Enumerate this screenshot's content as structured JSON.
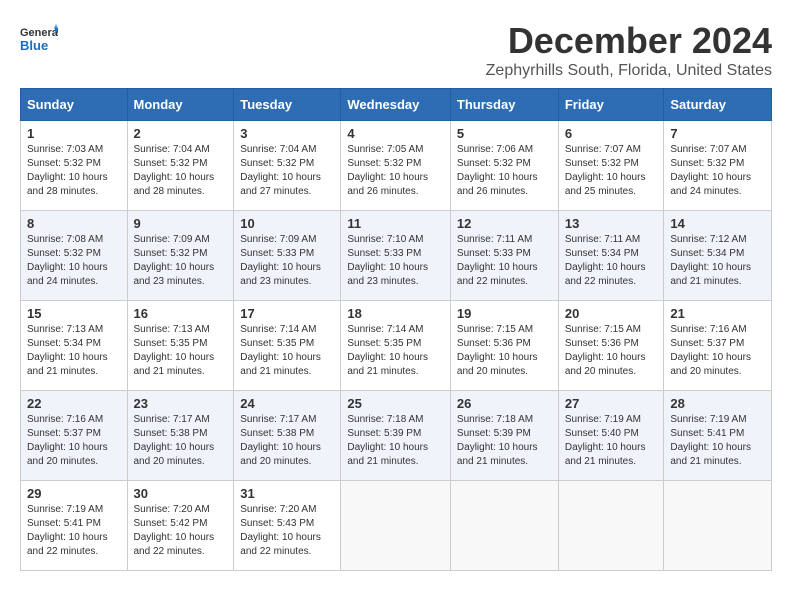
{
  "header": {
    "logo_general": "General",
    "logo_blue": "Blue",
    "month_title": "December 2024",
    "location": "Zephyrhills South, Florida, United States"
  },
  "weekdays": [
    "Sunday",
    "Monday",
    "Tuesday",
    "Wednesday",
    "Thursday",
    "Friday",
    "Saturday"
  ],
  "weeks": [
    [
      {
        "day": "1",
        "sunrise": "Sunrise: 7:03 AM",
        "sunset": "Sunset: 5:32 PM",
        "daylight": "Daylight: 10 hours and 28 minutes."
      },
      {
        "day": "2",
        "sunrise": "Sunrise: 7:04 AM",
        "sunset": "Sunset: 5:32 PM",
        "daylight": "Daylight: 10 hours and 28 minutes."
      },
      {
        "day": "3",
        "sunrise": "Sunrise: 7:04 AM",
        "sunset": "Sunset: 5:32 PM",
        "daylight": "Daylight: 10 hours and 27 minutes."
      },
      {
        "day": "4",
        "sunrise": "Sunrise: 7:05 AM",
        "sunset": "Sunset: 5:32 PM",
        "daylight": "Daylight: 10 hours and 26 minutes."
      },
      {
        "day": "5",
        "sunrise": "Sunrise: 7:06 AM",
        "sunset": "Sunset: 5:32 PM",
        "daylight": "Daylight: 10 hours and 26 minutes."
      },
      {
        "day": "6",
        "sunrise": "Sunrise: 7:07 AM",
        "sunset": "Sunset: 5:32 PM",
        "daylight": "Daylight: 10 hours and 25 minutes."
      },
      {
        "day": "7",
        "sunrise": "Sunrise: 7:07 AM",
        "sunset": "Sunset: 5:32 PM",
        "daylight": "Daylight: 10 hours and 24 minutes."
      }
    ],
    [
      {
        "day": "8",
        "sunrise": "Sunrise: 7:08 AM",
        "sunset": "Sunset: 5:32 PM",
        "daylight": "Daylight: 10 hours and 24 minutes."
      },
      {
        "day": "9",
        "sunrise": "Sunrise: 7:09 AM",
        "sunset": "Sunset: 5:32 PM",
        "daylight": "Daylight: 10 hours and 23 minutes."
      },
      {
        "day": "10",
        "sunrise": "Sunrise: 7:09 AM",
        "sunset": "Sunset: 5:33 PM",
        "daylight": "Daylight: 10 hours and 23 minutes."
      },
      {
        "day": "11",
        "sunrise": "Sunrise: 7:10 AM",
        "sunset": "Sunset: 5:33 PM",
        "daylight": "Daylight: 10 hours and 23 minutes."
      },
      {
        "day": "12",
        "sunrise": "Sunrise: 7:11 AM",
        "sunset": "Sunset: 5:33 PM",
        "daylight": "Daylight: 10 hours and 22 minutes."
      },
      {
        "day": "13",
        "sunrise": "Sunrise: 7:11 AM",
        "sunset": "Sunset: 5:34 PM",
        "daylight": "Daylight: 10 hours and 22 minutes."
      },
      {
        "day": "14",
        "sunrise": "Sunrise: 7:12 AM",
        "sunset": "Sunset: 5:34 PM",
        "daylight": "Daylight: 10 hours and 21 minutes."
      }
    ],
    [
      {
        "day": "15",
        "sunrise": "Sunrise: 7:13 AM",
        "sunset": "Sunset: 5:34 PM",
        "daylight": "Daylight: 10 hours and 21 minutes."
      },
      {
        "day": "16",
        "sunrise": "Sunrise: 7:13 AM",
        "sunset": "Sunset: 5:35 PM",
        "daylight": "Daylight: 10 hours and 21 minutes."
      },
      {
        "day": "17",
        "sunrise": "Sunrise: 7:14 AM",
        "sunset": "Sunset: 5:35 PM",
        "daylight": "Daylight: 10 hours and 21 minutes."
      },
      {
        "day": "18",
        "sunrise": "Sunrise: 7:14 AM",
        "sunset": "Sunset: 5:35 PM",
        "daylight": "Daylight: 10 hours and 21 minutes."
      },
      {
        "day": "19",
        "sunrise": "Sunrise: 7:15 AM",
        "sunset": "Sunset: 5:36 PM",
        "daylight": "Daylight: 10 hours and 20 minutes."
      },
      {
        "day": "20",
        "sunrise": "Sunrise: 7:15 AM",
        "sunset": "Sunset: 5:36 PM",
        "daylight": "Daylight: 10 hours and 20 minutes."
      },
      {
        "day": "21",
        "sunrise": "Sunrise: 7:16 AM",
        "sunset": "Sunset: 5:37 PM",
        "daylight": "Daylight: 10 hours and 20 minutes."
      }
    ],
    [
      {
        "day": "22",
        "sunrise": "Sunrise: 7:16 AM",
        "sunset": "Sunset: 5:37 PM",
        "daylight": "Daylight: 10 hours and 20 minutes."
      },
      {
        "day": "23",
        "sunrise": "Sunrise: 7:17 AM",
        "sunset": "Sunset: 5:38 PM",
        "daylight": "Daylight: 10 hours and 20 minutes."
      },
      {
        "day": "24",
        "sunrise": "Sunrise: 7:17 AM",
        "sunset": "Sunset: 5:38 PM",
        "daylight": "Daylight: 10 hours and 20 minutes."
      },
      {
        "day": "25",
        "sunrise": "Sunrise: 7:18 AM",
        "sunset": "Sunset: 5:39 PM",
        "daylight": "Daylight: 10 hours and 21 minutes."
      },
      {
        "day": "26",
        "sunrise": "Sunrise: 7:18 AM",
        "sunset": "Sunset: 5:39 PM",
        "daylight": "Daylight: 10 hours and 21 minutes."
      },
      {
        "day": "27",
        "sunrise": "Sunrise: 7:19 AM",
        "sunset": "Sunset: 5:40 PM",
        "daylight": "Daylight: 10 hours and 21 minutes."
      },
      {
        "day": "28",
        "sunrise": "Sunrise: 7:19 AM",
        "sunset": "Sunset: 5:41 PM",
        "daylight": "Daylight: 10 hours and 21 minutes."
      }
    ],
    [
      {
        "day": "29",
        "sunrise": "Sunrise: 7:19 AM",
        "sunset": "Sunset: 5:41 PM",
        "daylight": "Daylight: 10 hours and 22 minutes."
      },
      {
        "day": "30",
        "sunrise": "Sunrise: 7:20 AM",
        "sunset": "Sunset: 5:42 PM",
        "daylight": "Daylight: 10 hours and 22 minutes."
      },
      {
        "day": "31",
        "sunrise": "Sunrise: 7:20 AM",
        "sunset": "Sunset: 5:43 PM",
        "daylight": "Daylight: 10 hours and 22 minutes."
      },
      null,
      null,
      null,
      null
    ]
  ]
}
